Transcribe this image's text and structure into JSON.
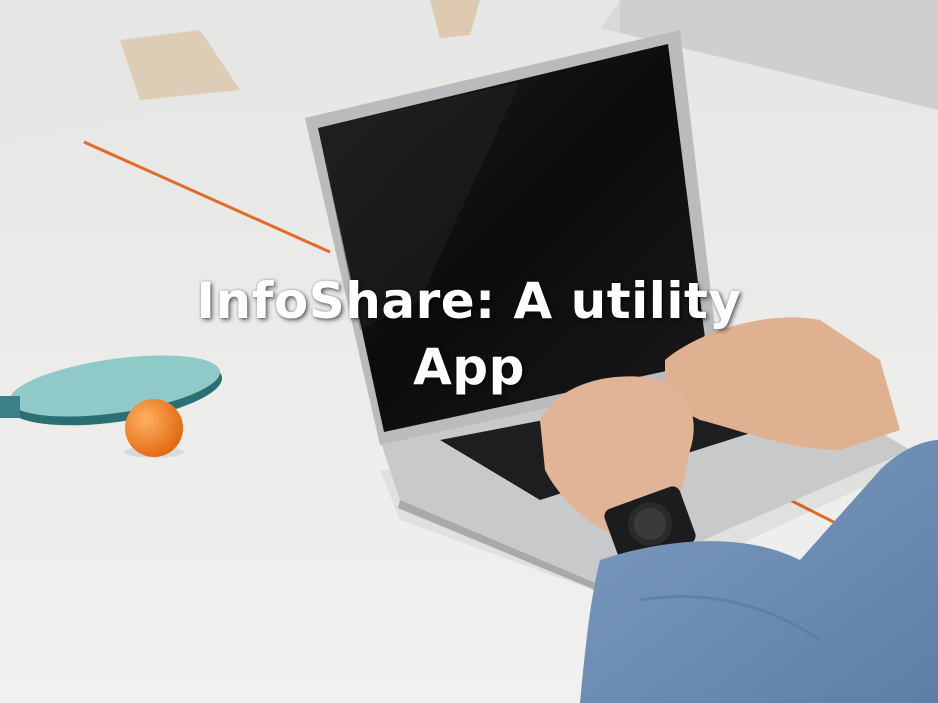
{
  "slide": {
    "title_line1": "InfoShare: A utility",
    "title_line2": "App"
  },
  "photo": {
    "subject": "person typing on a laptop at a white table tennis table",
    "icons": [
      "laptop-icon",
      "paddle-icon",
      "ball-icon",
      "watch-icon"
    ],
    "colors": {
      "table": "#ececea",
      "wall": "#d8d8d6",
      "line": "#e46a2a",
      "screen": "#121214",
      "laptop": "#c9cbcd",
      "skin": "#e2b497",
      "sleeve": "#6f8fb6",
      "paddle": "#8fc9c8",
      "ball": "#f07a1e",
      "text": "#ffffff"
    }
  }
}
